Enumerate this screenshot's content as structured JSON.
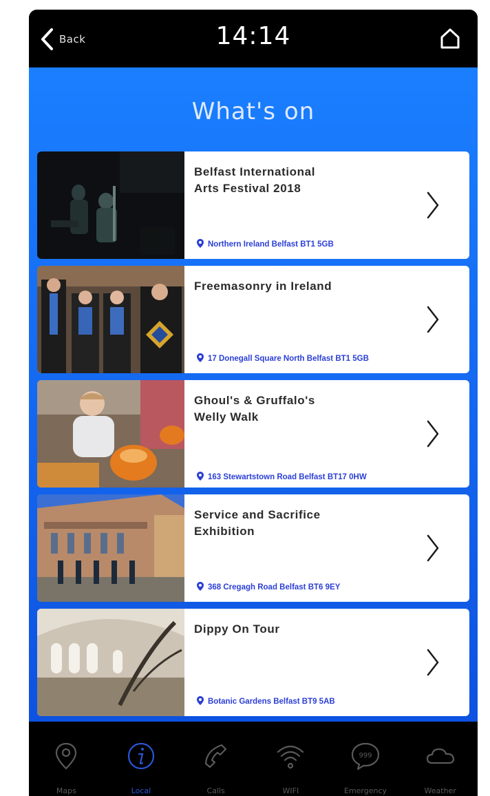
{
  "topbar": {
    "back_label": "Back",
    "time": "14:14"
  },
  "main": {
    "title": "What's on"
  },
  "events": [
    {
      "title": "Belfast International\nArts Festival 2018",
      "location": "Northern Ireland Belfast BT1 5GB"
    },
    {
      "title": "Freemasonry in Ireland",
      "location": "17 Donegall Square North Belfast BT1 5GB"
    },
    {
      "title": "Ghoul's & Gruffalo's\nWelly Walk",
      "location": "163 Stewartstown Road Belfast BT17 0HW"
    },
    {
      "title": "Service and Sacrifice\nExhibition",
      "location": "368 Cregagh Road Belfast BT6 9EY"
    },
    {
      "title": "Dippy On Tour",
      "location": "Botanic Gardens Belfast BT9 5AB"
    }
  ],
  "tabs": [
    {
      "label": "Maps",
      "icon": "map-pin-icon"
    },
    {
      "label": "Local",
      "icon": "info-icon"
    },
    {
      "label": "Calls",
      "icon": "phone-icon"
    },
    {
      "label": "WIFI",
      "icon": "wifi-icon"
    },
    {
      "label": "Emergency",
      "icon": "emergency-999-icon"
    },
    {
      "label": "Weather",
      "icon": "cloud-icon"
    }
  ],
  "active_tab": "Local",
  "colors": {
    "accent": "#1a7fff",
    "location_text": "#2b3fd6",
    "active_tab": "#2a55d8",
    "inactive_tab": "#5a5a5a"
  }
}
